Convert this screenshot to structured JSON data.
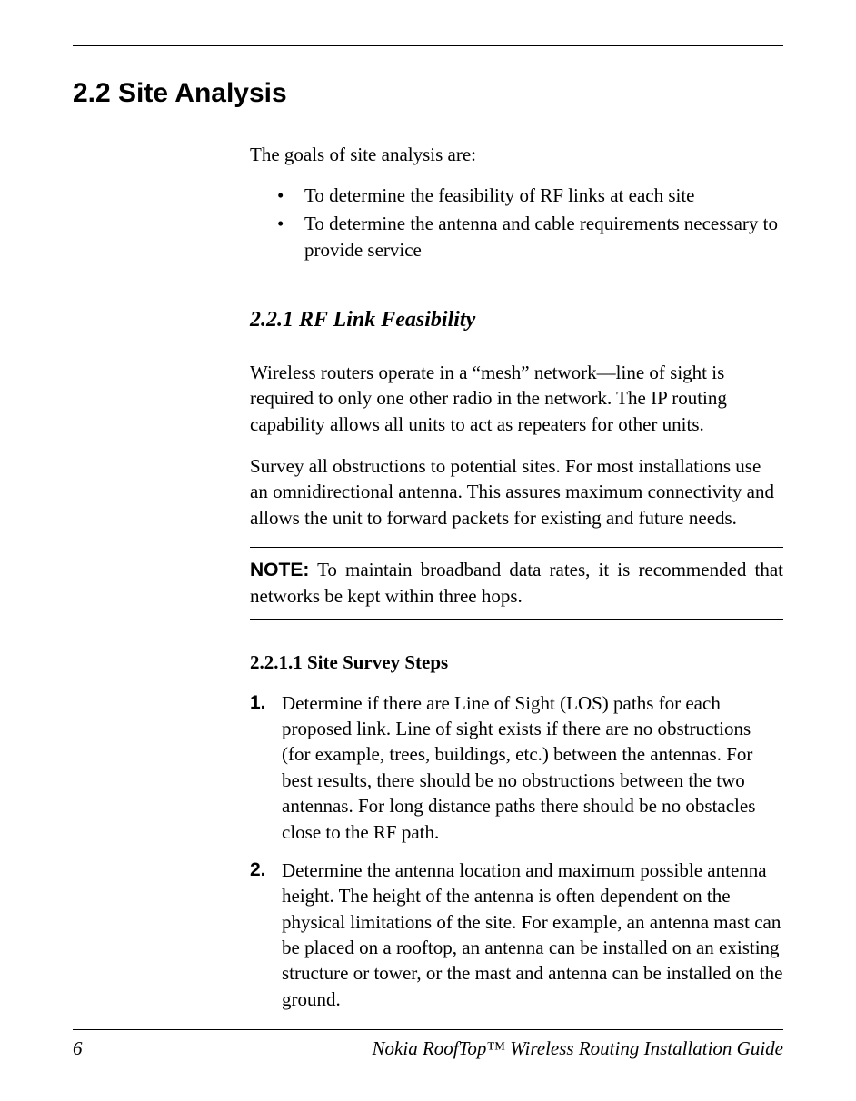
{
  "heading": "2.2 Site Analysis",
  "intro": "The goals of site analysis are:",
  "bullets": [
    "To determine the feasibility of RF links at each site",
    "To determine the antenna and cable requirements necessary to provide service"
  ],
  "subsection": {
    "heading": "2.2.1 RF Link Feasibility",
    "para1": "Wireless routers operate in a “mesh” network—line of sight is required to only one other radio in the network. The IP routing capability allows all units to act as repeaters for other units.",
    "para2": "Survey all obstructions to potential sites. For most installations use an omnidirectional antenna. This assures maximum connectivity and allows the unit to forward packets for existing and future needs.",
    "note_label": "NOTE:",
    "note_text": " To maintain broadband data rates, it is recommended that networks be kept within three hops.",
    "subsub_heading": "2.2.1.1 Site Survey Steps",
    "steps": [
      {
        "num": "1.",
        "text": "Determine if there are Line of Sight (LOS) paths for each proposed link. Line of sight exists if there are no obstructions (for example, trees, buildings, etc.) between the antennas. For best results, there should be no obstructions between the two antennas. For long distance paths there should be no obstacles close to the RF path."
      },
      {
        "num": "2.",
        "text": "Determine the antenna location and maximum possible antenna height. The height of the antenna is often dependent on the physical limitations of the site. For example, an antenna mast can be placed on a rooftop, an antenna can be installed on an existing structure or tower, or the mast and antenna can be installed on the ground."
      }
    ]
  },
  "footer": {
    "page": "6",
    "title": "Nokia RoofTop™ Wireless Routing Installation Guide"
  }
}
